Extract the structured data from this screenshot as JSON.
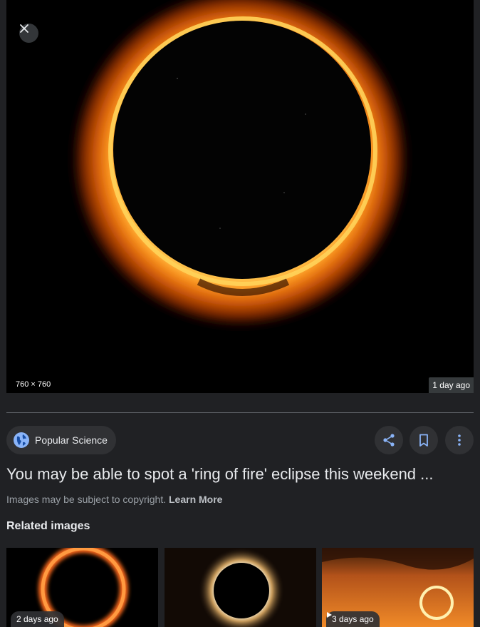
{
  "hero": {
    "dimensions": "760 × 760",
    "age": "1 day ago"
  },
  "source": {
    "name": "Popular Science",
    "icon": "globe-icon"
  },
  "actions": {
    "share_icon": "share-icon",
    "save_icon": "bookmark-icon",
    "more_icon": "more-vert-icon"
  },
  "result": {
    "title": "You may be able to spot a 'ring of fire' eclipse this weekend ...",
    "copyright_text": "Images may be subject to copyright.",
    "learn_more": "Learn More"
  },
  "related": {
    "heading": "Related images",
    "items": [
      {
        "age": "2 days ago",
        "is_video": false
      },
      {
        "age": "",
        "is_video": false
      },
      {
        "age": "3 days ago",
        "is_video": true
      }
    ]
  },
  "colors": {
    "background": "#202124",
    "chip": "#303134",
    "accent": "#8ab4f8"
  }
}
